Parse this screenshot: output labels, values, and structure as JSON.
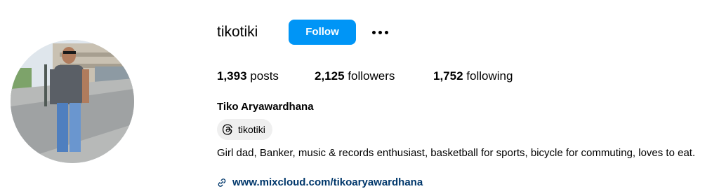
{
  "profile": {
    "username": "tikotiki",
    "full_name": "Tiko Aryawardhana",
    "follow_label": "Follow",
    "threads_handle": "tikotiki",
    "bio": "Girl dad, Banker, music & records enthusiast, basketball for sports, bicycle for commuting, loves to eat.",
    "link": "www.mixcloud.com/tikoaryawardhana"
  },
  "stats": {
    "posts_count": "1,393",
    "posts_label": "posts",
    "followers_count": "2,125",
    "followers_label": "followers",
    "following_count": "1,752",
    "following_label": "following"
  },
  "icons": {
    "more": "more-options-icon",
    "threads": "threads-icon",
    "link": "link-icon"
  },
  "colors": {
    "follow_button": "#0095f6",
    "link_text": "#00376b",
    "pill_background": "#efefef"
  }
}
